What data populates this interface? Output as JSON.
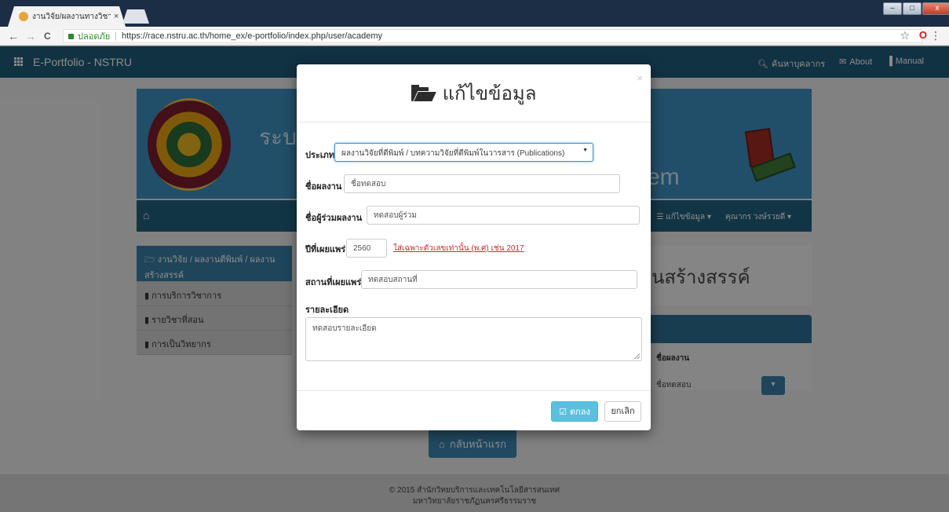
{
  "browser": {
    "tab_title": "งานวิจัย/ผลงานทางวิชาการ | ",
    "tab_close": "×",
    "secure_label": "ปลอดภัย",
    "url": "https://race.nstru.ac.th/home_ex/e-portfolio/index.php/user/academy",
    "back_glyph": "←",
    "forward_glyph": "→",
    "reload_glyph": "C",
    "star_glyph": "☆",
    "opera_glyph": "O",
    "menu_glyph": "⋮",
    "win_min": "–",
    "win_max": "□",
    "win_close": "x"
  },
  "navbar": {
    "brand": "E-Portfolio - NSTRU",
    "items": [
      {
        "icon": "search-icon",
        "glyph": "🔍︎",
        "label": "ค้นหาบุคลากร"
      },
      {
        "icon": "envelope-icon",
        "glyph": "✉",
        "label": "About"
      },
      {
        "icon": "file-icon",
        "glyph": "▐",
        "label": "Manual"
      }
    ]
  },
  "banner": {
    "text_left": "ระบ",
    "text_right": "em"
  },
  "subnav": {
    "home_glyph": "⌂",
    "edit_menu": "☰ แก้ไขข้อมูล ▾",
    "user_menu": "คุณากร วงษ์รวยดี ▾"
  },
  "sidebar": {
    "items": [
      {
        "label": "🗁 งานวิจัย / ผลงานตีพิมพ์ / ผลงานสร้างสรรค์",
        "active": true
      },
      {
        "label": "▮ การบริการวิชาการ",
        "active": false
      },
      {
        "label": "▮ รายวิชาที่สอน",
        "active": false
      },
      {
        "label": "▮ การเป็นวิทยากร",
        "active": false
      }
    ]
  },
  "content": {
    "title_tail": "นสร้างสรรค์",
    "table_header": "ชื่อผลงาน",
    "table_cell": "ชื่อทดสอบ",
    "dropdown_glyph": "▾"
  },
  "page_buttons": {
    "back_home": "กลับหน้าแรก",
    "home_glyph": "⌂"
  },
  "footer": {
    "line1": "© 2015 สำนักวิทยบริการและเทคโนโลยีสารสนเทศ",
    "line2": "มหาวิทยาลัยราชภัฏนครศรีธรรมราช"
  },
  "modal": {
    "title": "แก้ไขข้อมูล",
    "close_glyph": "×",
    "type_label": "ประเภท",
    "type_value": "ผลงานวิจัยที่ตีพิมพ์ / บทความวิจัยที่ตีพิมพ์ในวารสาร (Publications)",
    "type_arrow": "▼",
    "name_label": "ชื่อผลงาน",
    "name_value": "ชื่อทดสอบ",
    "coauthor_label": "ชื่อผู้ร่วมผลงาน",
    "coauthor_value": "ทดสอบผู้ร่วม",
    "year_label": "ปีที่เผยแพร่",
    "year_value": "2560",
    "year_hint": "ใส่เฉพาะตัวเลขเท่านั้น (พ.ศ) เช่น 2017",
    "place_label": "สถานที่เผยแพร่",
    "place_value": "ทดสอบสถานที่",
    "detail_label": "รายละเอียด",
    "detail_value": "ทดสอบรายละเอียด",
    "ok_label": "ตกลง",
    "ok_glyph": "☑",
    "cancel_label": "ยกเลิก"
  },
  "colors": {
    "navbar": "#1e5c78",
    "accent": "#3a7fa6",
    "ok_button": "#5bc0de",
    "hint": "#d9262a"
  }
}
